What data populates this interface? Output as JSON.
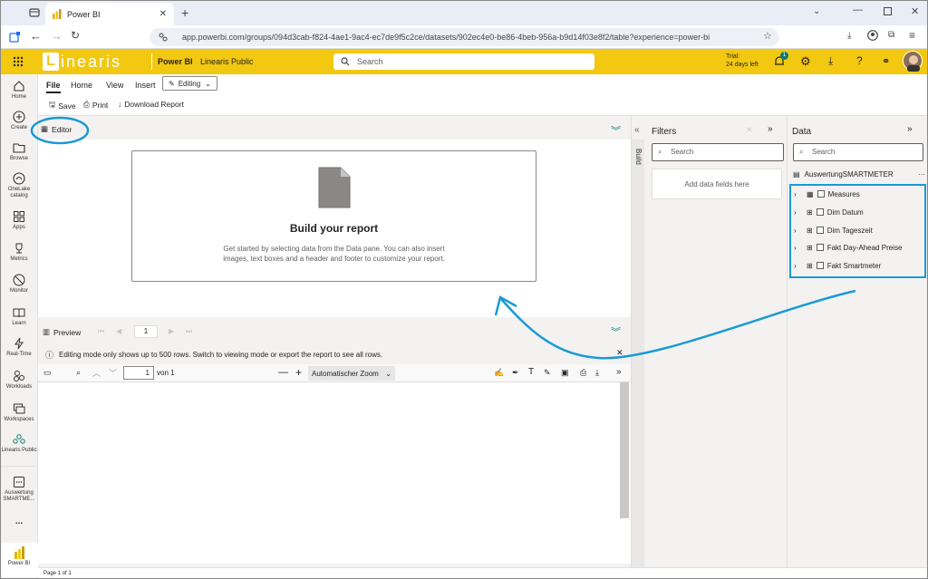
{
  "browser": {
    "tab_title": "Power BI",
    "url": "app.powerbi.com/groups/094d3cab-f824-4ae1-9ac4-ec7de9f5c2ce/datasets/902ec4e0-be86-4beb-956a-b9d14f03e8f2/table?experience=power-bi"
  },
  "header": {
    "logo_text": "inearis",
    "logo_letter": "L",
    "product": "Power BI",
    "workspace": "Linearis Public",
    "search_placeholder": "Search",
    "trial_line1": "Trial:",
    "trial_line2": "24 days left",
    "notif_count": "1"
  },
  "rail": {
    "items": [
      {
        "label": "Home"
      },
      {
        "label": "Create"
      },
      {
        "label": "Browse"
      },
      {
        "label": "OneLake catalog"
      },
      {
        "label": "Apps"
      },
      {
        "label": "Metrics"
      },
      {
        "label": "Monitor"
      },
      {
        "label": "Learn"
      },
      {
        "label": "Real-Time"
      },
      {
        "label": "Workloads"
      },
      {
        "label": "Workspaces"
      },
      {
        "label": "Linearis Public"
      },
      {
        "label": "Auswertung SMARTME..."
      },
      {
        "label": "..."
      },
      {
        "label": "Power BI"
      }
    ]
  },
  "ribbon": {
    "tabs": [
      "File",
      "Home",
      "View",
      "Insert"
    ],
    "mode": "Editing",
    "save": "Save",
    "print": "Print",
    "download": "Download Report"
  },
  "editor": {
    "label": "Editor",
    "card_title": "Build your report",
    "card_text": "Get started by selecting data from the Data pane. You can also insert images, text boxes and a header and footer to customize your report."
  },
  "preview": {
    "label": "Preview",
    "page": "1",
    "info": "Editing mode only shows up to 500 rows. Switch to viewing mode or export the report to see all rows.",
    "pdf_page": "1",
    "pdf_of": "von 1",
    "zoom": "Automatischer Zoom"
  },
  "filters": {
    "title": "Filters",
    "search_placeholder": "Search",
    "add_fields": "Add data fields here",
    "build_label": "Build"
  },
  "data": {
    "title": "Data",
    "search_placeholder": "Search",
    "model": "AuswertungSMARTMETER",
    "fields": [
      "Measures",
      "Dim Datum",
      "Dim Tageszeit",
      "Fakt Day-Ahead Preise",
      "Fakt Smartmeter"
    ]
  },
  "status": {
    "page": "Page 1 of 1"
  },
  "colors": {
    "brand_yellow": "#f2c811",
    "annotation_blue": "#1a9ad6"
  }
}
